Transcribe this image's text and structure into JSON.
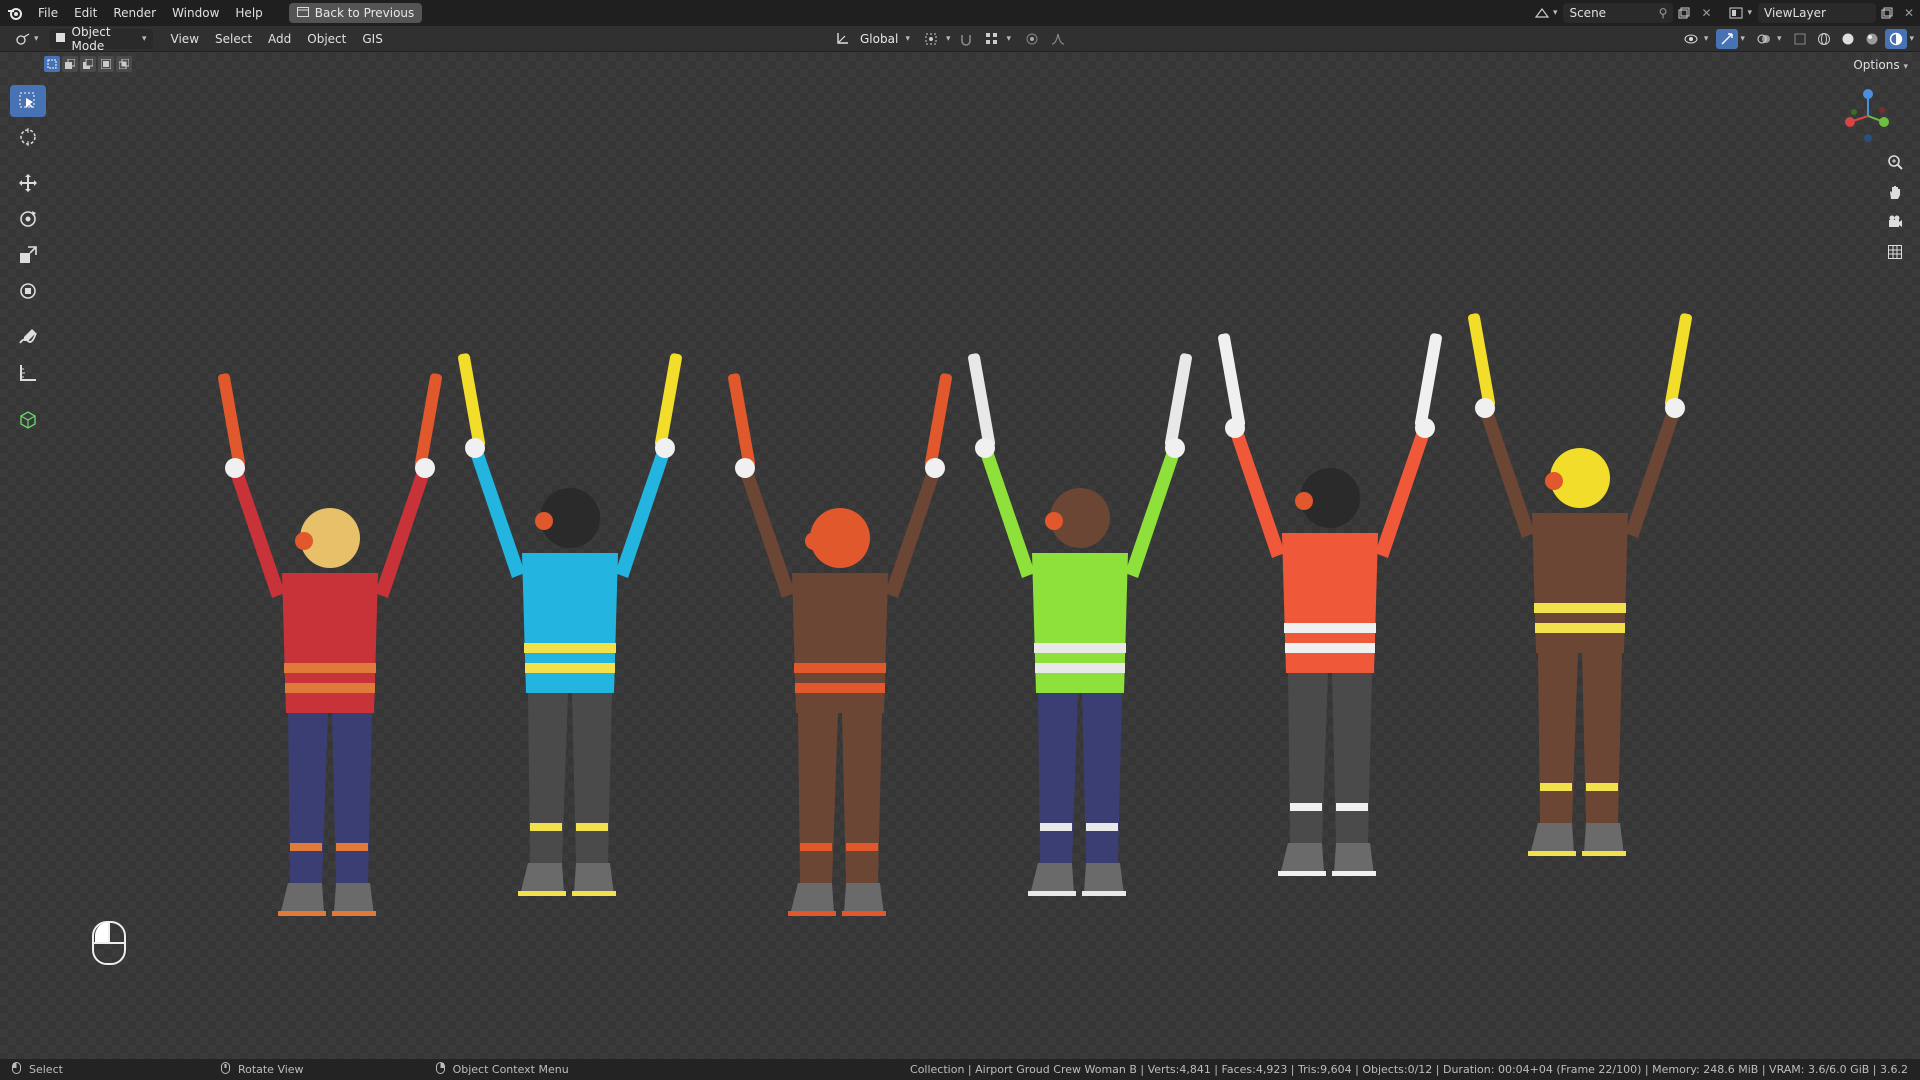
{
  "menu": {
    "items": [
      "File",
      "Edit",
      "Render",
      "Window",
      "Help"
    ],
    "back_button": "Back to Previous"
  },
  "top_right": {
    "scene_name": "Scene",
    "view_layer_name": "ViewLayer"
  },
  "header": {
    "mode": "Object Mode",
    "menus": [
      "View",
      "Select",
      "Add",
      "Object",
      "GIS"
    ],
    "transform_orientation": "Global"
  },
  "viewport": {
    "options_label": "Options",
    "toolbar": [
      "select-box",
      "cursor",
      "move",
      "rotate",
      "scale",
      "transform",
      "annotate",
      "measure",
      "add-cube"
    ],
    "active_tool": "select-box"
  },
  "scene": {
    "figures": [
      {
        "shirt": "#c8333a",
        "stripe": "#e07a3a",
        "pants": "#3b3e72",
        "stick": "#e0582b",
        "hair": "#e8c06a"
      },
      {
        "shirt": "#23b4e0",
        "stripe": "#f2e14a",
        "pants": "#4a4a4a",
        "stick": "#f2dd2a",
        "hair": "#2a2a2a"
      },
      {
        "shirt": "#6b4635",
        "stripe": "#e0582b",
        "pants": "#6b4635",
        "stick": "#e0582b",
        "hair": "#e0582b"
      },
      {
        "shirt": "#8ee03a",
        "stripe": "#e8e8e8",
        "pants": "#3b3e72",
        "stick": "#e8e8e8",
        "hair": "#6b4635"
      },
      {
        "shirt": "#f0583a",
        "stripe": "#f0f0f0",
        "pants": "#4a4a4a",
        "stick": "#f0f0f0",
        "hair": "#2a2a2a"
      },
      {
        "shirt": "#6b4635",
        "stripe": "#f2e14a",
        "pants": "#6b4635",
        "stick": "#f2dd2a",
        "hair": "#f2dd2a"
      }
    ]
  },
  "status": {
    "left_items": [
      "Select",
      "Rotate View",
      "Object Context Menu"
    ],
    "info": "Collection | Airport Groud Crew Woman B | Verts:4,841 | Faces:4,923 | Tris:9,604 | Objects:0/12 | Duration: 00:04+04 (Frame 22/100) | Memory: 248.6 MiB | VRAM: 3.6/6.0 GiB | 3.6.2"
  }
}
